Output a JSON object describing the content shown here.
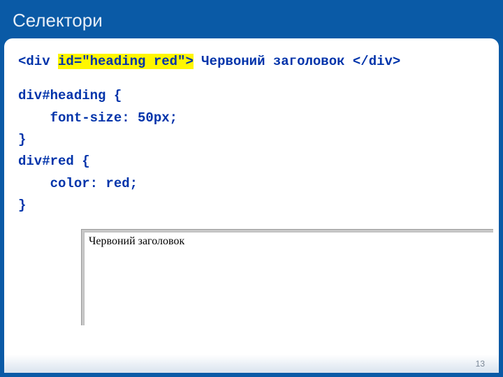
{
  "title": "Селектори",
  "code": {
    "line1": {
      "open_tag": "<div ",
      "attr": "id=\"heading red\">",
      "text": " Червоний заголовок ",
      "close_tag": "</div>"
    },
    "line2": "div#heading {",
    "line3": "    font-size: 50px;",
    "line4": "}",
    "line5": "div#red {",
    "line6": "    color: red;",
    "line7": "}"
  },
  "preview": {
    "text": "Червоний заголовок"
  },
  "page_number": "13"
}
